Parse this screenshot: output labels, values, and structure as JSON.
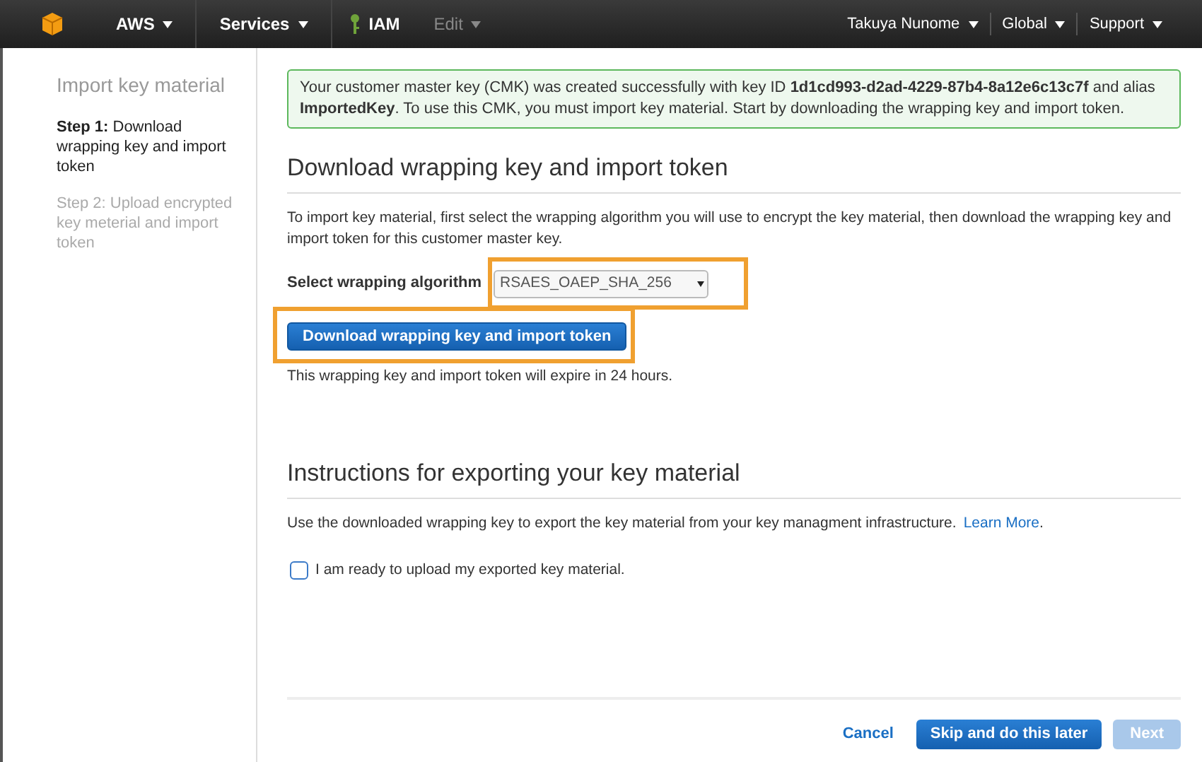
{
  "nav": {
    "left": [
      {
        "label": "AWS",
        "kind": "menu"
      },
      {
        "label": "Services",
        "kind": "menu"
      },
      {
        "label": "IAM",
        "kind": "service"
      },
      {
        "label": "Edit",
        "kind": "disabled"
      }
    ],
    "right": [
      {
        "label": "Takuya Nunome"
      },
      {
        "label": "Global"
      },
      {
        "label": "Support"
      }
    ]
  },
  "sidebar": {
    "title": "Import key material",
    "steps": [
      {
        "label": "**Step 1:** Download wrapping key and import token",
        "selected": true
      },
      {
        "label": "Step 2: Upload encrypted key meterial and import token",
        "selected": false
      }
    ]
  },
  "alert": {
    "text": "Your customer master key (CMK) was created successfully with key ID **1d1cd993-d2ad-4229-87b4-8a12e6c13c7f** and alias **ImportedKey**. To use this CMK, you must import key material. Start by downloading the wrapping key and import token."
  },
  "download_section": {
    "heading": "Download wrapping key and import token",
    "description": "To import key material, first select the wrapping algorithm you will use to encrypt the key material, then download the wrapping key and import token for this customer master key.",
    "algorithm_label": "Select wrapping algorithm",
    "algorithm_value": "RSAES_OAEP_SHA_256",
    "button": "Download wrapping key and import token",
    "note": "This wrapping key and import token will expire in 24 hours."
  },
  "instructions_section": {
    "heading": "Instructions for exporting your key material",
    "text": "Use the downloaded wrapping key to export the key material from your key managment infrastructure.",
    "link": "Learn More",
    "link_suffix": ".",
    "checkbox": {
      "label": "I am ready to upload my exported key material.",
      "checked": false
    }
  },
  "footer": {
    "cancel": "Cancel",
    "skip": "Skip and do this later",
    "next": {
      "label": "Next",
      "disabled": true
    }
  }
}
